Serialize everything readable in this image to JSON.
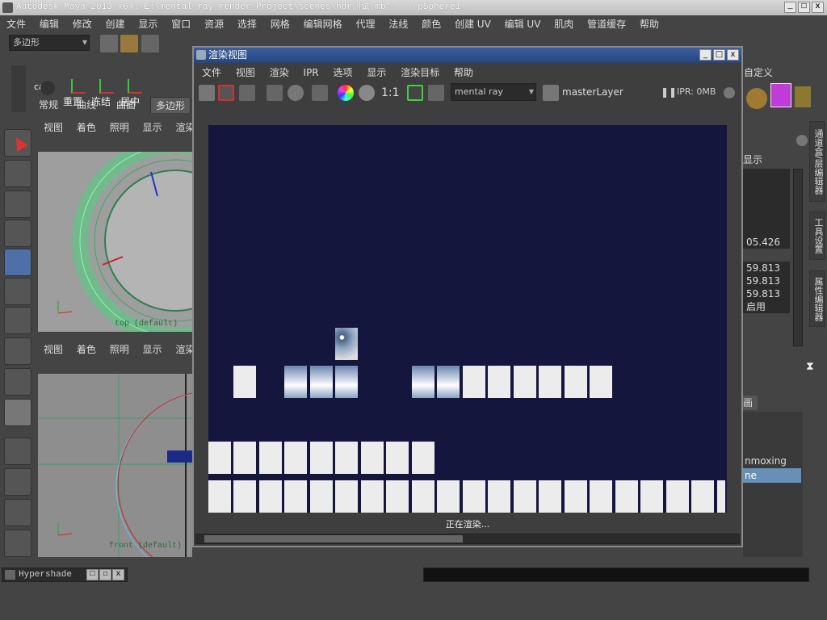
{
  "window": {
    "title": "Autodesk Maya 2013 x64: E:\\mental ray render_Project\\scenes\\hdr测试.mb*  ---  pSphere1",
    "controls": [
      "_",
      "□",
      "x"
    ]
  },
  "main_menu": [
    "文件",
    "编辑",
    "修改",
    "创建",
    "显示",
    "窗口",
    "资源",
    "选择",
    "网格",
    "编辑网格",
    "代理",
    "法线",
    "颜色",
    "创建 UV",
    "编辑 UV",
    "肌肉",
    "管道缓存",
    "帮助"
  ],
  "status_line": {
    "mode": "多边形"
  },
  "shelf": {
    "tabs": [
      "常规",
      "曲线",
      "曲面",
      "多边形"
    ],
    "active_tab": "多边形",
    "right_tab": "自定义",
    "buttons": [
      "cam",
      "重置",
      "冻结",
      "居中"
    ]
  },
  "viewports": {
    "menu": [
      "视图",
      "着色",
      "照明",
      "显示",
      "渲染"
    ],
    "top_label": "top (default)",
    "front_label": "front (default)"
  },
  "render_view": {
    "title": "渲染视图",
    "menu": [
      "文件",
      "视图",
      "渲染",
      "IPR",
      "选项",
      "显示",
      "渲染目标",
      "帮助"
    ],
    "ratio_label": "1:1",
    "renderer": "mental ray",
    "layer": "masterLayer",
    "ipr_status": "IPR: 0MB",
    "status": "正在渲染..."
  },
  "channel_box": {
    "display_label": "显示",
    "values": [
      "05.426",
      "59.813",
      "59.813",
      "59.813"
    ],
    "enabled_label": "启用",
    "tab_label": "画",
    "layer_items": [
      "nmoxing",
      "ne"
    ]
  },
  "side_tabs": [
    "通道盒/层编辑器",
    "工具设置",
    "属性编辑器"
  ],
  "bottom": {
    "hypershade_label": "Hypershade",
    "controls": [
      "□",
      "☐",
      "x"
    ]
  },
  "colors": {
    "render_bg": "#14163d",
    "title_active": "#2c4d87",
    "ui_bg": "#444444",
    "tile": "#ececec"
  }
}
